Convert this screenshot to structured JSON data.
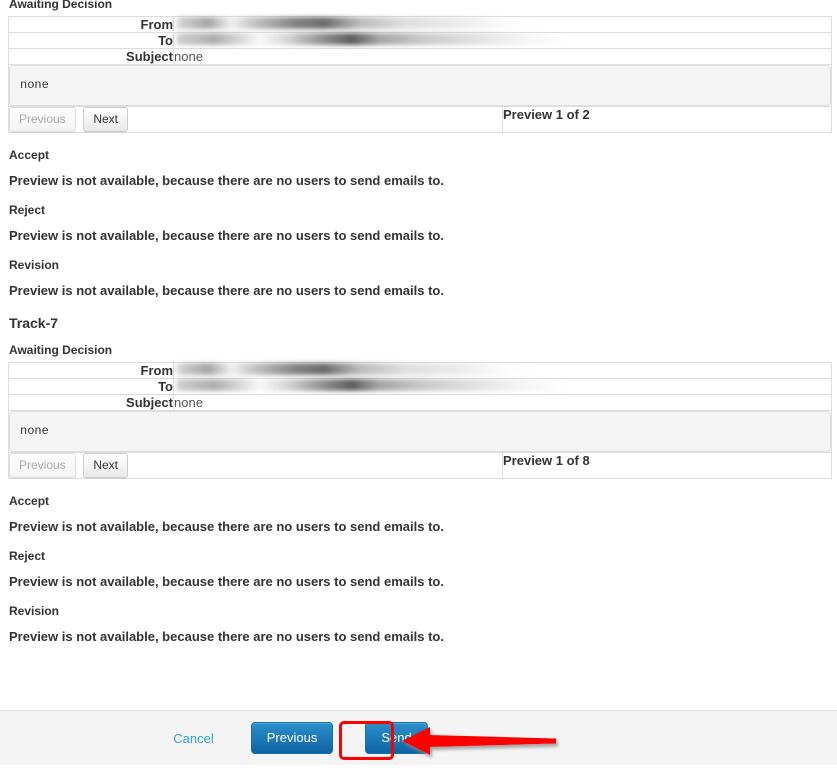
{
  "sections": [
    {
      "track_title": null,
      "status_label": "Awaiting Decision",
      "table": {
        "from_label": "From",
        "from_value": "",
        "to_label": "To",
        "to_value": "",
        "subject_label": "Subject",
        "subject_value": "none",
        "body_value": "none",
        "previous_label": "Previous",
        "next_label": "Next",
        "counter_text": "Preview 1 of 2"
      },
      "outcomes": [
        {
          "label": "Accept",
          "message": "Preview is not available, because there are no users to send emails to."
        },
        {
          "label": "Reject",
          "message": "Preview is not available, because there are no users to send emails to."
        },
        {
          "label": "Revision",
          "message": "Preview is not available, because there are no users to send emails to."
        }
      ]
    },
    {
      "track_title": "Track-7",
      "status_label": "Awaiting Decision",
      "table": {
        "from_label": "From",
        "from_value": "",
        "to_label": "To",
        "to_value": "",
        "subject_label": "Subject",
        "subject_value": "none",
        "body_value": "none",
        "previous_label": "Previous",
        "next_label": "Next",
        "counter_text": "Preview 1 of 8"
      },
      "outcomes": [
        {
          "label": "Accept",
          "message": "Preview is not available, because there are no users to send emails to."
        },
        {
          "label": "Reject",
          "message": "Preview is not available, because there are no users to send emails to."
        },
        {
          "label": "Revision",
          "message": "Preview is not available, because there are no users to send emails to."
        }
      ]
    }
  ],
  "footer": {
    "cancel_label": "Cancel",
    "previous_label": "Previous",
    "send_label": "Send"
  },
  "annotation": {
    "highlight_target": "Send",
    "color": "#ff0000",
    "shapes": [
      "rounded-rectangle-outline",
      "left-pointing-arrow"
    ]
  },
  "colors": {
    "primary_button": "#1e7cbb",
    "link": "#2fa4c7",
    "annotation_red": "#ff0000",
    "footer_bg": "#f4f4f4",
    "body_box_bg": "#f5f5f5",
    "table_border": "#dddddd"
  }
}
